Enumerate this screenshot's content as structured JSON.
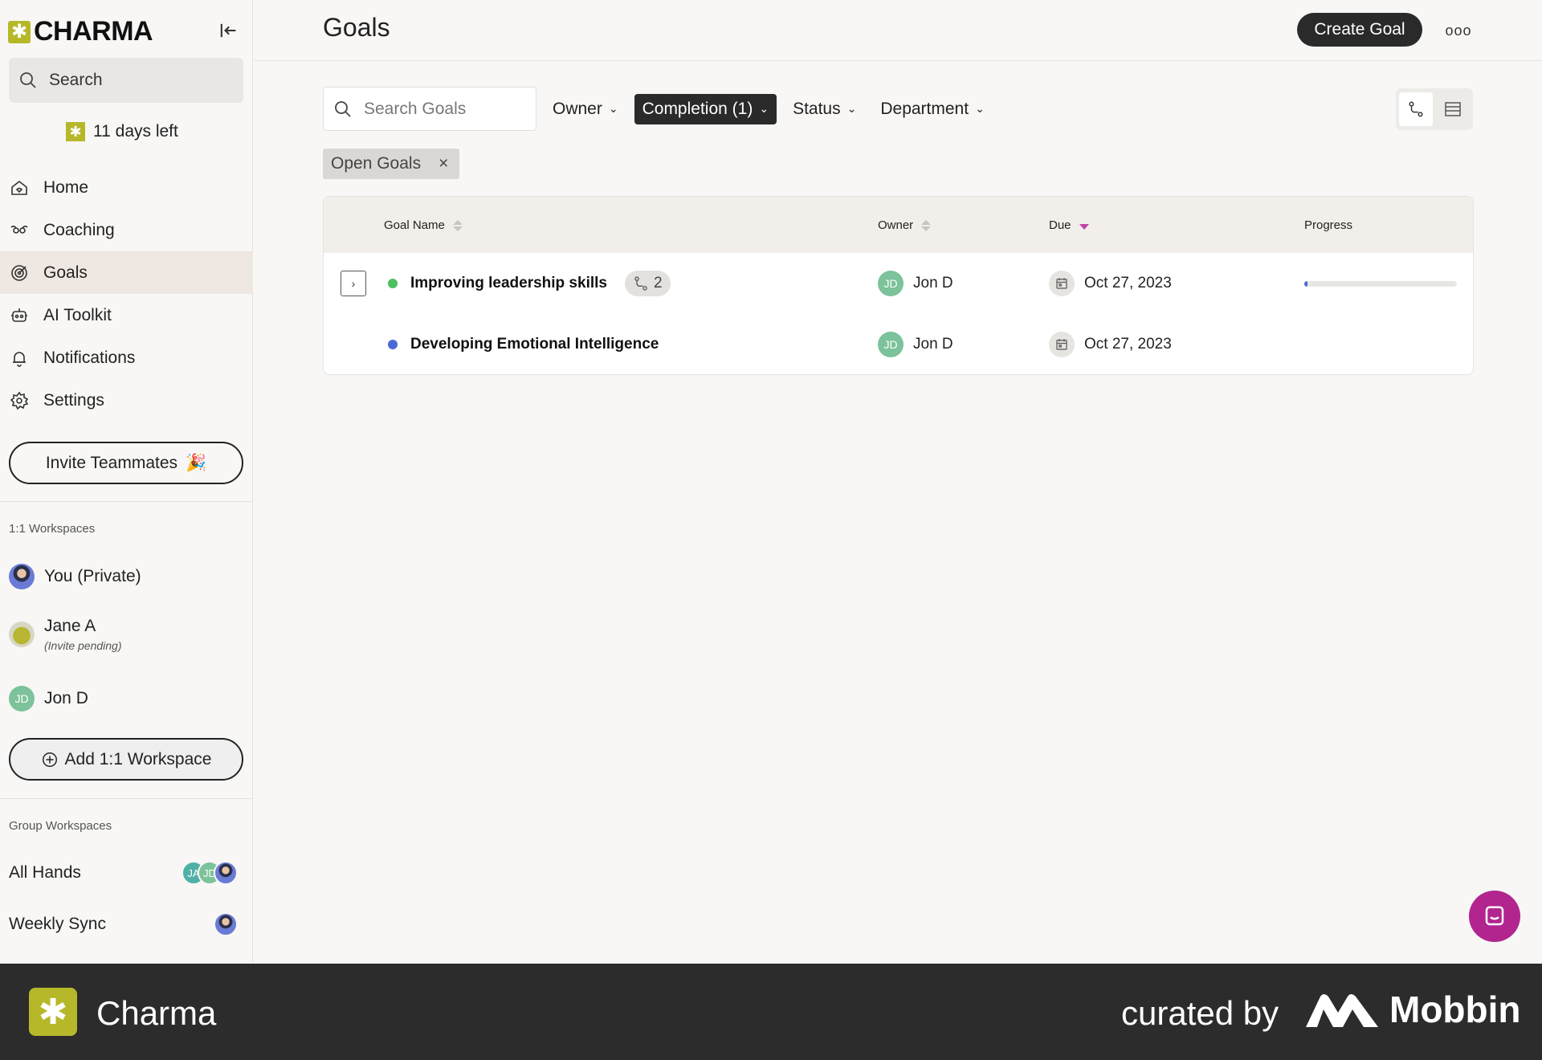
{
  "brand": {
    "name": "CHARMA"
  },
  "sidebar": {
    "search_label": "Search",
    "trial_text": "11 days left",
    "nav": [
      {
        "label": "Home",
        "icon": "home-icon"
      },
      {
        "label": "Coaching",
        "icon": "coaching-icon"
      },
      {
        "label": "Goals",
        "icon": "goals-icon",
        "active": true
      },
      {
        "label": "AI Toolkit",
        "icon": "robot-icon"
      },
      {
        "label": "Notifications",
        "icon": "bell-icon"
      },
      {
        "label": "Settings",
        "icon": "gear-icon"
      }
    ],
    "invite_label": "Invite Teammates",
    "one_on_one_label": "1:1 Workspaces",
    "workspaces": [
      {
        "name": "You (Private)"
      },
      {
        "name": "Jane A",
        "sub": "(Invite pending)"
      },
      {
        "name": "Jon D",
        "initials": "JD"
      }
    ],
    "add_workspace_label": "Add 1:1 Workspace",
    "group_label": "Group Workspaces",
    "groups": [
      {
        "name": "All Hands",
        "avatars": [
          "JA",
          "JD"
        ]
      },
      {
        "name": "Weekly Sync"
      }
    ]
  },
  "header": {
    "title": "Goals",
    "create_label": "Create Goal",
    "more_label": "ooo"
  },
  "filters": {
    "search_placeholder": "Search Goals",
    "owner": "Owner",
    "completion": "Completion (1)",
    "status": "Status",
    "department": "Department"
  },
  "chip": {
    "label": "Open Goals",
    "close": "×"
  },
  "table": {
    "columns": {
      "name": "Goal Name",
      "owner": "Owner",
      "due": "Due",
      "progress": "Progress"
    },
    "rows": [
      {
        "name": "Improving leadership skills",
        "dot_color": "#4cbf5e",
        "subgoals": "2",
        "owner": "Jon D",
        "owner_initials": "JD",
        "due": "Oct 27, 2023",
        "progress": 0.02,
        "expandable": true
      },
      {
        "name": "Developing Emotional Intelligence",
        "dot_color": "#4a69d4",
        "owner": "Jon D",
        "owner_initials": "JD",
        "due": "Oct 27, 2023"
      }
    ]
  },
  "footer": {
    "app_name": "Charma",
    "curated_by": "curated by",
    "mobbin": "Mobbin"
  },
  "colors": {
    "brand": "#b6b82a",
    "active_sort": "#c042a8",
    "chat": "#b2258f"
  }
}
